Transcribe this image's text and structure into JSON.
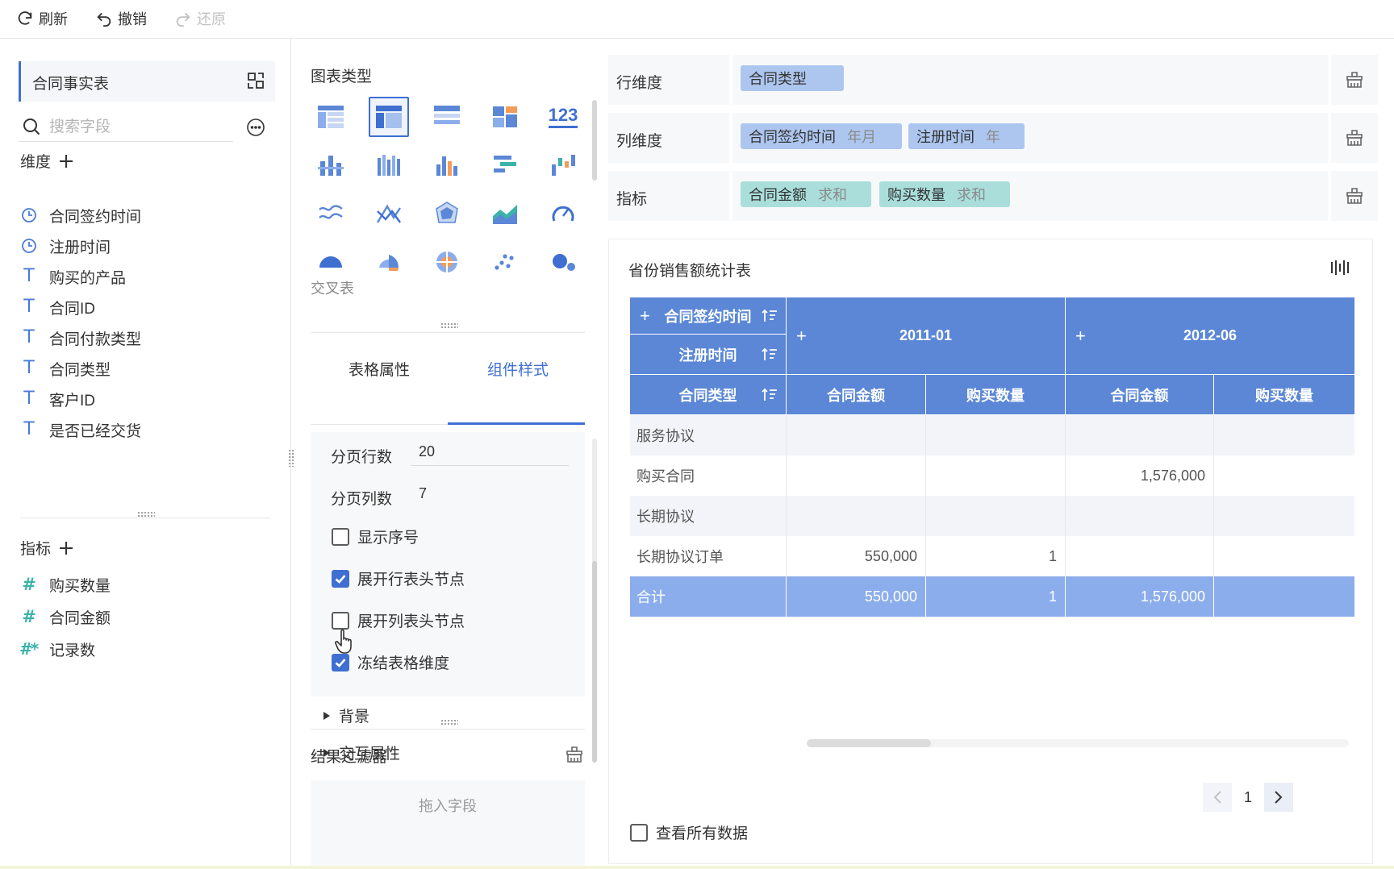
{
  "toolbar": {
    "refresh": "刷新",
    "undo": "撤销",
    "redo": "还原"
  },
  "datasource": {
    "name": "合同事实表",
    "search_placeholder": "搜索字段"
  },
  "dimensions": {
    "title": "维度",
    "items": [
      {
        "label": "合同签约时间",
        "icon": "clock-icon"
      },
      {
        "label": "注册时间",
        "icon": "clock-icon"
      },
      {
        "label": "购买的产品",
        "icon": "text-type-icon"
      },
      {
        "label": "合同ID",
        "icon": "text-type-icon"
      },
      {
        "label": "合同付款类型",
        "icon": "text-type-icon"
      },
      {
        "label": "合同类型",
        "icon": "text-type-icon"
      },
      {
        "label": "客户ID",
        "icon": "text-type-icon"
      },
      {
        "label": "是否已经交货",
        "icon": "text-type-icon"
      }
    ]
  },
  "measures": {
    "title": "指标",
    "items": [
      {
        "label": "购买数量",
        "icon": "number-type-icon"
      },
      {
        "label": "合同金额",
        "icon": "number-type-icon"
      },
      {
        "label": "记录数",
        "icon": "count-type-icon"
      }
    ]
  },
  "chart_types": {
    "title": "图表类型",
    "tooltip": "交叉表",
    "number_icon_text": "123"
  },
  "tabs": {
    "table_props": "表格属性",
    "component_style": "组件样式"
  },
  "props": {
    "page_rows_label": "分页行数",
    "page_rows_value": "20",
    "page_cols_label": "分页列数",
    "page_cols_value": "7",
    "checkboxes": [
      {
        "label": "显示序号",
        "checked": false
      },
      {
        "label": "展开行表头节点",
        "checked": true
      },
      {
        "label": "展开列表头节点",
        "checked": false
      },
      {
        "label": "冻结表格维度",
        "checked": true
      }
    ],
    "background": "背景",
    "interaction": "交互属性"
  },
  "filter": {
    "title": "结果过滤器",
    "dropzone": "拖入字段"
  },
  "shelves": {
    "row": {
      "label": "行维度",
      "chips": [
        {
          "name": "合同类型",
          "sub": ""
        }
      ]
    },
    "col": {
      "label": "列维度",
      "chips": [
        {
          "name": "合同签约时间",
          "sub": "年月"
        },
        {
          "name": "注册时间",
          "sub": "年"
        }
      ]
    },
    "measure": {
      "label": "指标",
      "chips": [
        {
          "name": "合同金额",
          "sub": "求和"
        },
        {
          "name": "购买数量",
          "sub": "求和"
        }
      ]
    }
  },
  "table": {
    "title": "省份销售额统计表",
    "header_sign_time": "合同签约时间",
    "header_reg_time": "注册时间",
    "header_type": "合同类型",
    "col_2011": "2011-01",
    "col_2012": "2012-06",
    "measure_amount": "合同金额",
    "measure_qty": "购买数量",
    "rows": [
      {
        "label": "服务协议",
        "a1": "",
        "q1": "",
        "a2": "",
        "q2": ""
      },
      {
        "label": "购买合同",
        "a1": "",
        "q1": "",
        "a2": "1,576,000",
        "q2": ""
      },
      {
        "label": "长期协议",
        "a1": "",
        "q1": "",
        "a2": "",
        "q2": ""
      },
      {
        "label": "长期协议订单",
        "a1": "550,000",
        "q1": "1",
        "a2": "",
        "q2": ""
      }
    ],
    "total": {
      "label": "合计",
      "a1": "550,000",
      "q1": "1",
      "a2": "1,576,000",
      "q2": ""
    },
    "page": "1",
    "view_all": "查看所有数据"
  },
  "colors": {
    "accent": "#3f6fd1",
    "header": "#5b87d6",
    "total_row": "#8cadec",
    "chip_blue": "#adc6ef",
    "chip_green": "#a9dedb"
  }
}
